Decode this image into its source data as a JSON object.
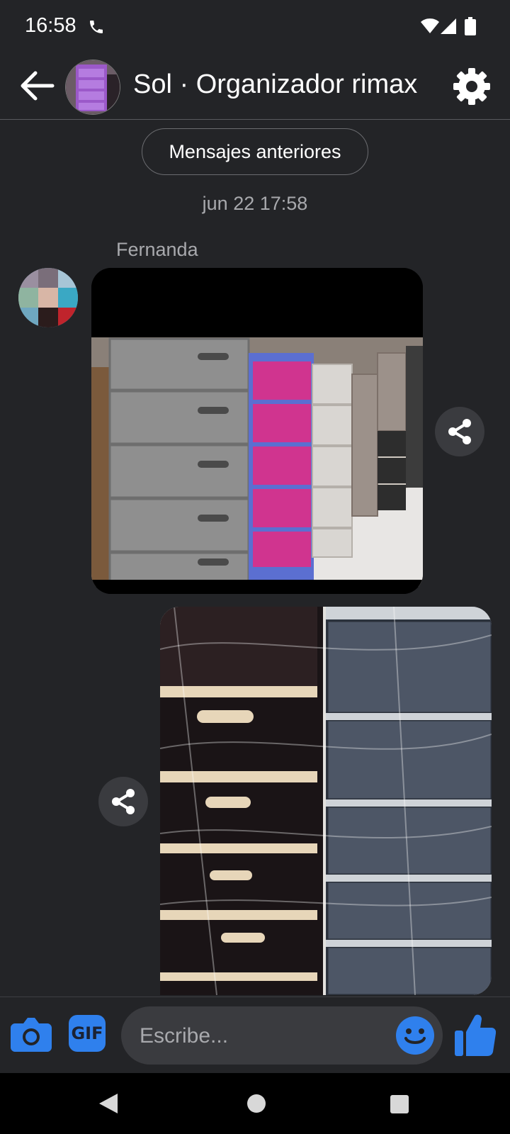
{
  "status_bar": {
    "time": "16:58"
  },
  "header": {
    "title": "Sol · Organizador rimax"
  },
  "conversation": {
    "older_messages_label": "Mensajes anteriores",
    "timestamp": "jun 22 17:58",
    "sender_name": "Fernanda"
  },
  "composer": {
    "placeholder": "Escribe...",
    "gif_label": "GIF"
  },
  "colors": {
    "accent": "#2f80ed",
    "background": "#232427",
    "bubble": "#3a3b3f"
  }
}
